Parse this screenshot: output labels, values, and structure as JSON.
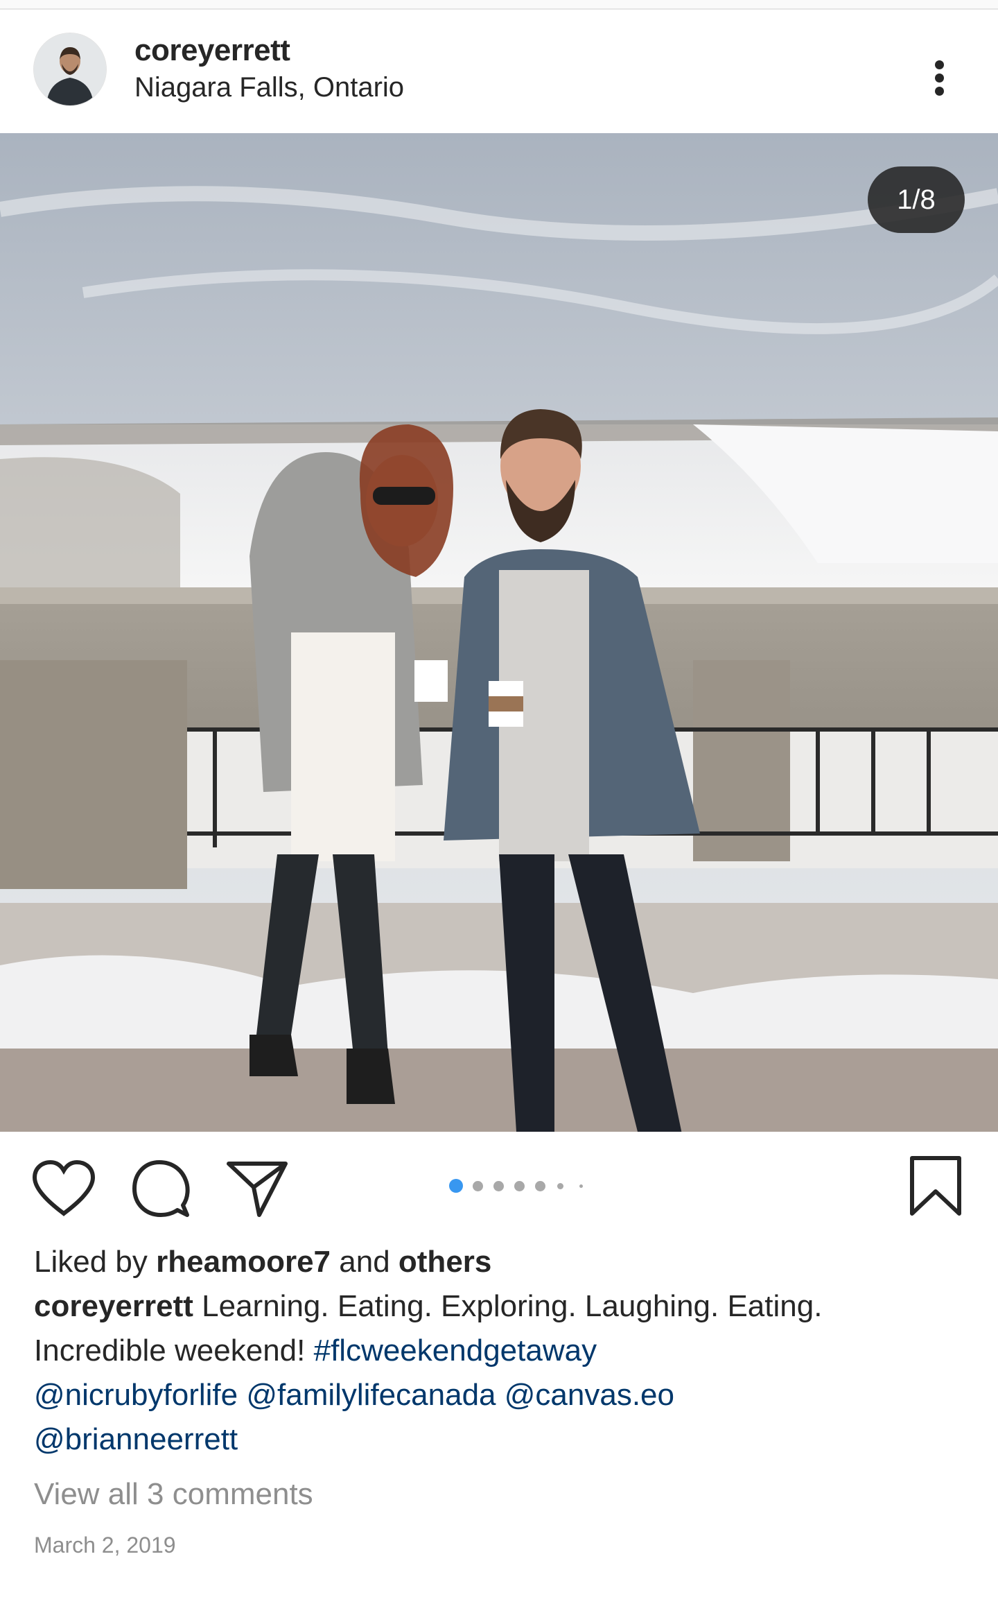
{
  "header": {
    "username": "coreyerrett",
    "location": "Niagara Falls, Ontario",
    "avatar_icon": "profile-photo",
    "more_icon": "more-vertical-icon"
  },
  "media": {
    "counter": "1/8",
    "current_index": 1,
    "total": 8,
    "scene_description_icon": "photo-couple-niagara-falls"
  },
  "actions": {
    "like_icon": "heart-icon",
    "comment_icon": "comment-bubble-icon",
    "share_icon": "paper-plane-icon",
    "save_icon": "bookmark-icon"
  },
  "carousel_dots": {
    "active": 0,
    "count": 7,
    "active_color": "#3897f0",
    "inactive_color": "#a8a8a8"
  },
  "likes": {
    "prefix": "Liked by",
    "user": "rheamoore7",
    "joiner": "and",
    "others": "others"
  },
  "caption": {
    "author": "coreyerrett",
    "text_line1": "Learning. Eating. Exploring. Laughing. Eating.",
    "text_line2": "Incredible weekend!",
    "hashtag": "#flcweekendgetaway",
    "mentions": [
      "@nicrubyforlife",
      "@familylifecanada",
      "@canvas.eo",
      "@brianneerrett"
    ]
  },
  "comments_link": "View all 3 comments",
  "date": "March 2, 2019"
}
